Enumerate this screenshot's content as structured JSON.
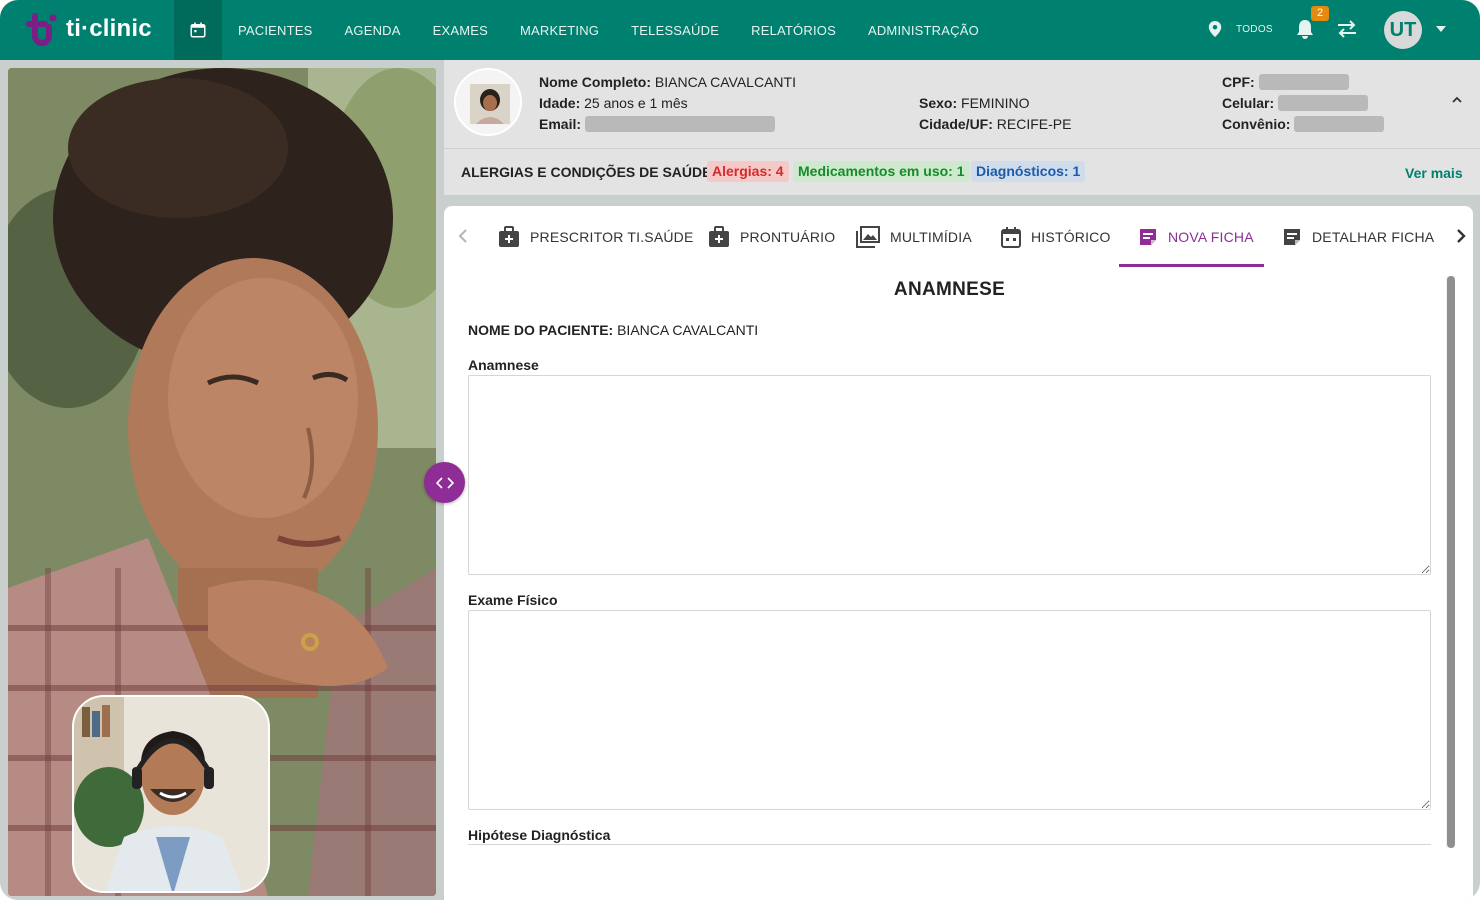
{
  "app": {
    "brand": "ti·clinic",
    "colors": {
      "primary": "#00806e",
      "accent": "#8e2d96",
      "badge": "#e48a0f"
    }
  },
  "topbar": {
    "nav": [
      "PACIENTES",
      "AGENDA",
      "EXAMES",
      "MARKETING",
      "TELESSAÚDE",
      "RELATÓRIOS",
      "ADMINISTRAÇÃO"
    ],
    "location_label": "TODOS",
    "notification_count": "2",
    "user_initials": "UT"
  },
  "patient": {
    "name_label": "Nome Completo:",
    "name": "BIANCA CAVALCANTI",
    "age_label": "Idade:",
    "age": "25 anos e 1 mês",
    "email_label": "Email:",
    "sex_label": "Sexo:",
    "sex": "FEMININO",
    "city_label": "Cidade/UF:",
    "city": "RECIFE-PE",
    "cpf_label": "CPF:",
    "phone_label": "Celular:",
    "insurance_label": "Convênio:"
  },
  "health": {
    "title": "ALERGIAS E CONDIÇÕES DE SAÚDE:",
    "allergies": "Alergias: 4",
    "medications": "Medicamentos em uso: 1",
    "diagnoses": "Diagnósticos: 1",
    "more": "Ver mais"
  },
  "tabs": [
    {
      "label": "PRESCRITOR TI.SAÚDE",
      "icon": "medical-bag-icon"
    },
    {
      "label": "PRONTUÁRIO",
      "icon": "medical-bag-icon"
    },
    {
      "label": "MULTIMÍDIA",
      "icon": "images-icon"
    },
    {
      "label": "HISTÓRICO",
      "icon": "calendar-icon"
    },
    {
      "label": "NOVA FICHA",
      "icon": "note-icon",
      "active": true
    },
    {
      "label": "DETALHAR FICHA",
      "icon": "note-icon"
    }
  ],
  "form": {
    "title": "ANAMNESE",
    "patient_label": "NOME DO PACIENTE:",
    "patient_value": "BIANCA CAVALCANTI",
    "fields": [
      "Anamnese",
      "Exame Físico",
      "Hipótese Diagnóstica"
    ]
  }
}
